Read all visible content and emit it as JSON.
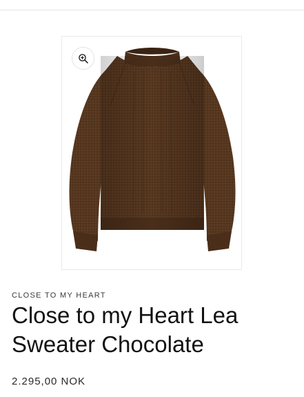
{
  "product": {
    "vendor": "CLOSE TO MY HEART",
    "title": "Close to my Heart Lea Sweater Chocolate",
    "price": "2.295,00 NOK",
    "image_alt": "Close to my Heart Lea Sweater Chocolate"
  },
  "icons": {
    "zoom": "zoom-in-icon"
  },
  "colors": {
    "sweater": "#5a3a22",
    "sweater_dark": "#3e2615",
    "text": "#121212",
    "border": "#e9e9e9"
  }
}
